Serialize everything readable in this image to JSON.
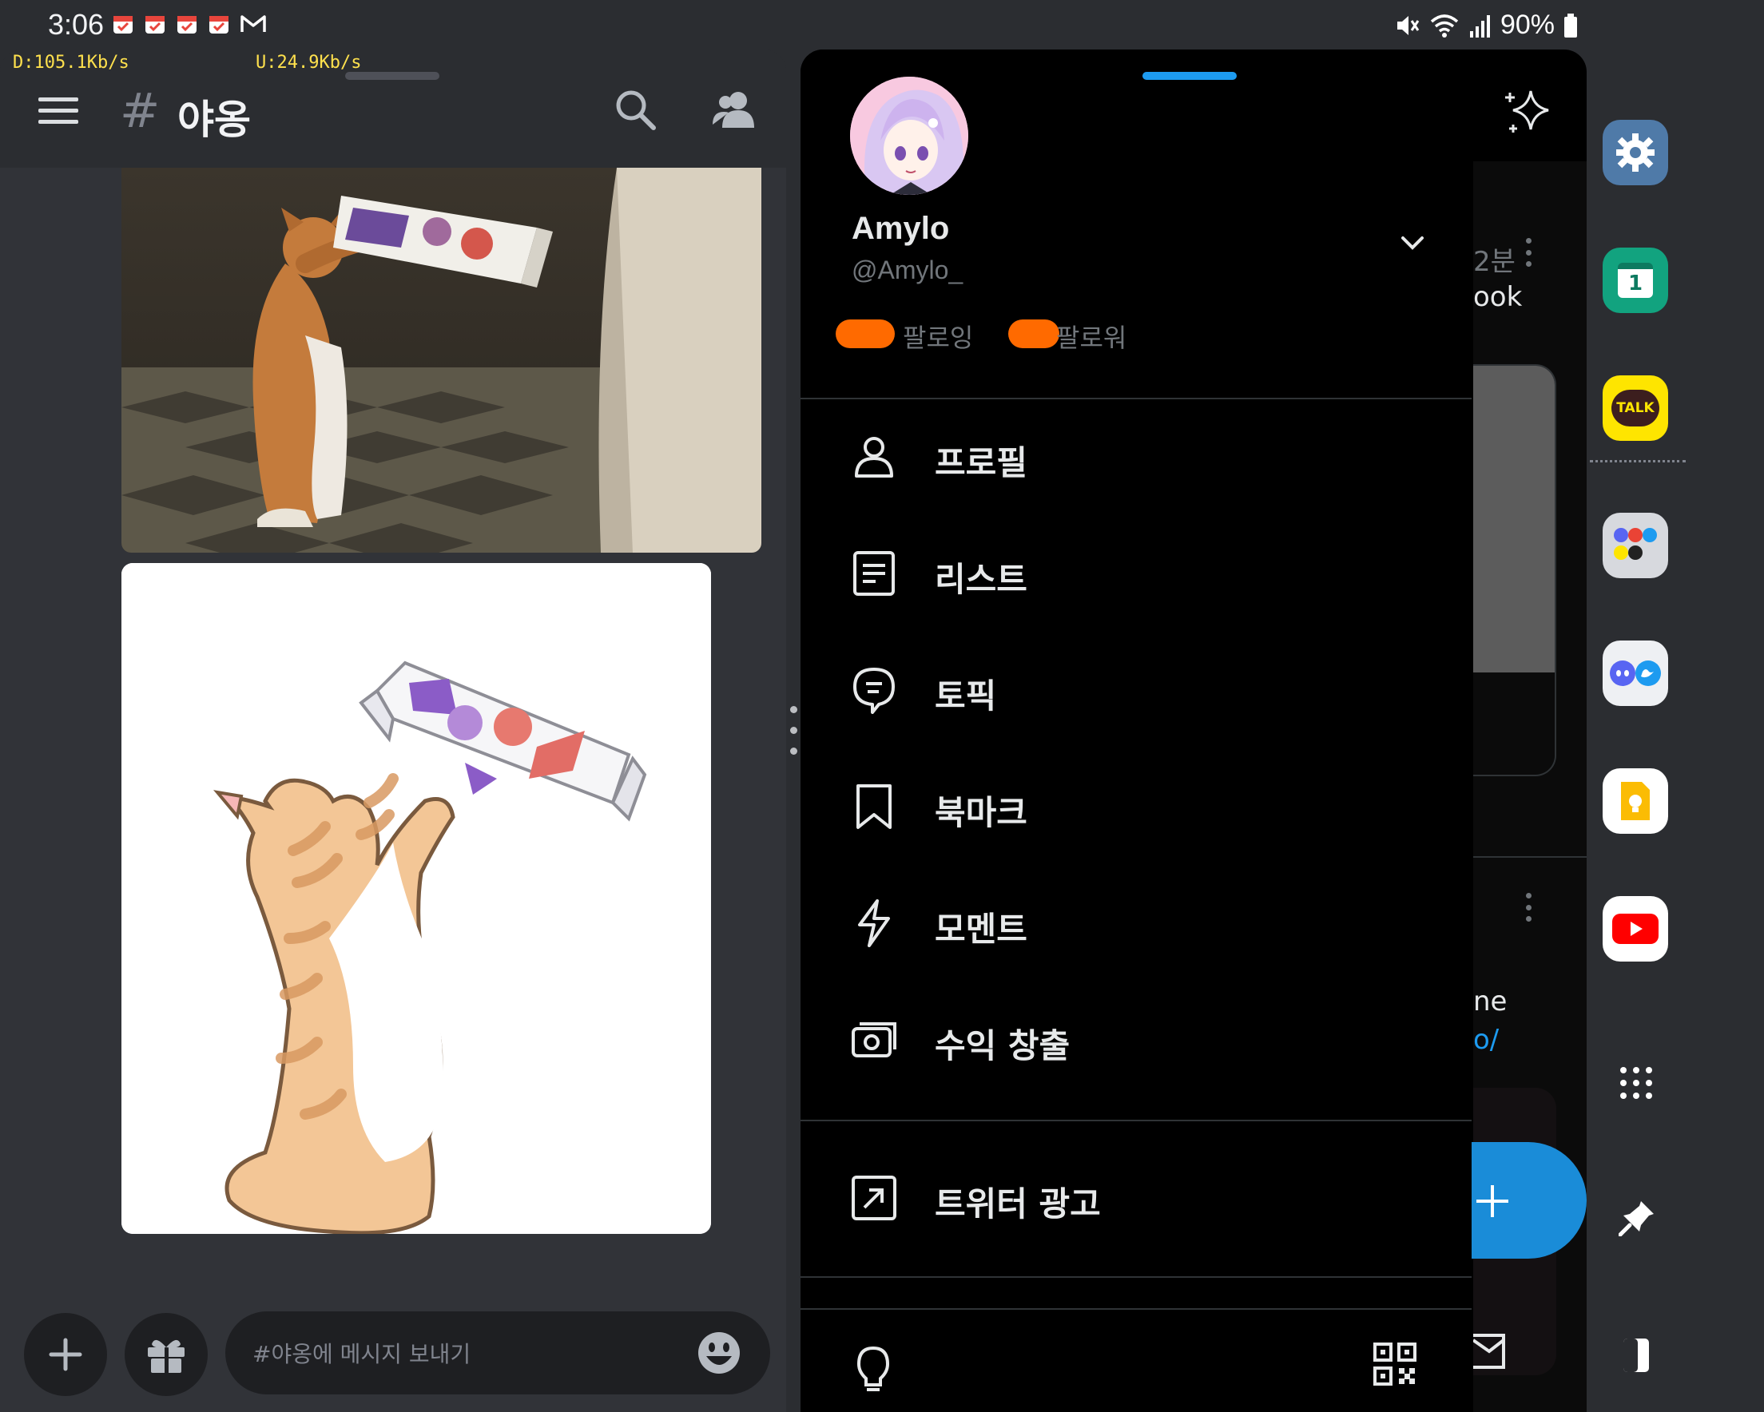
{
  "status_bar": {
    "time": "3:06",
    "download_speed": "D:105.1Kb/s",
    "upload_speed": "U:24.9Kb/s",
    "battery": "90%",
    "icons": [
      "calendar-icon",
      "calendar-icon",
      "calendar-icon",
      "calendar-icon",
      "gmail-icon",
      "mute-icon",
      "wifi-icon",
      "signal-icon",
      "battery-icon"
    ]
  },
  "discord": {
    "channel_hash": "#",
    "channel_name": "야옹",
    "message_placeholder": "#야옹에 메시지 보내기",
    "images": [
      "cat-drinking-milk-photo",
      "cat-drinking-milk-drawing"
    ]
  },
  "twitter": {
    "display_name": "Amylo",
    "handle": "@Amylo_",
    "following_label": "팔로잉",
    "followers_label": "팔로워",
    "menu_items": [
      {
        "label": "프로필",
        "icon": "person-icon"
      },
      {
        "label": "리스트",
        "icon": "list-icon"
      },
      {
        "label": "토픽",
        "icon": "topic-icon"
      },
      {
        "label": "북마크",
        "icon": "bookmark-icon"
      },
      {
        "label": "모멘트",
        "icon": "lightning-icon"
      },
      {
        "label": "수익 창출",
        "icon": "money-icon"
      }
    ],
    "ads_label": "트위터 광고",
    "background_fragments": [
      "2분",
      "ook",
      "ne",
      "o/"
    ]
  },
  "dock": {
    "apps": [
      "settings-app",
      "calendar-app",
      "kakaotalk-app",
      "app-pair-multi",
      "discord-twitter-pair",
      "keep-app",
      "youtube-app"
    ],
    "kakao_label": "TALK",
    "calendar_day": "1"
  },
  "colors": {
    "discord_bg": "#313338",
    "discord_header": "#2b2d31",
    "twitter_blue": "#1d9bf0",
    "redaction_orange": "#ff6a00"
  }
}
